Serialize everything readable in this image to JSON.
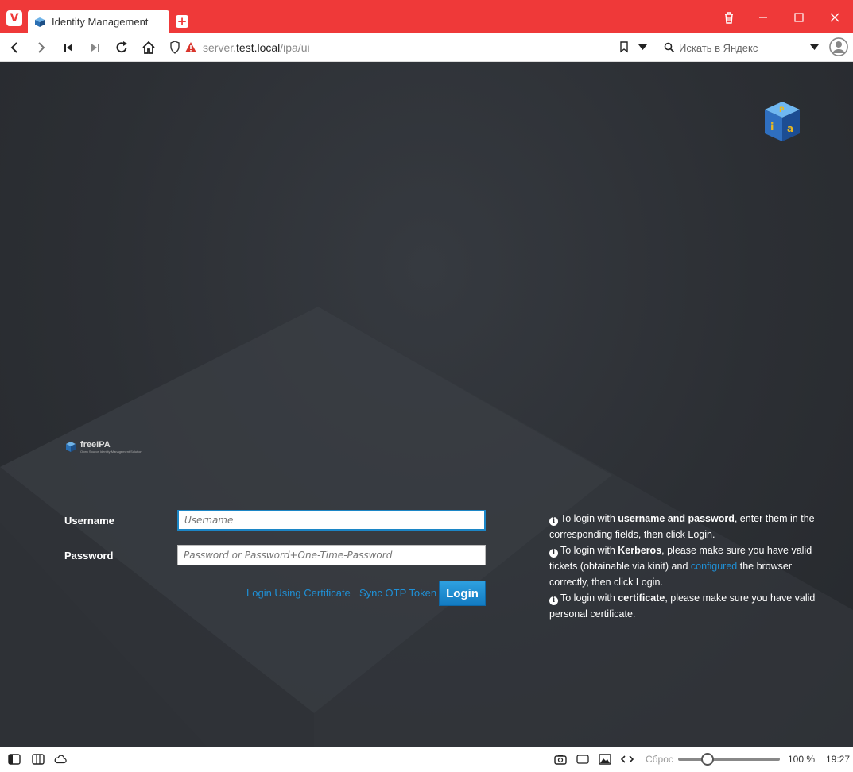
{
  "browser": {
    "tab_title": "Identity Management",
    "url_host": "server.test.local",
    "url_prefix": "server.",
    "url_domain": "test.local",
    "url_path": "/ipa/ui",
    "search_placeholder": "Искать в Яндекс",
    "accent_color": "#ef3939"
  },
  "brand": {
    "name": "freeIPA",
    "tagline": "Open Source Identity Management Solution"
  },
  "login_form": {
    "username_label": "Username",
    "username_placeholder": "Username",
    "password_label": "Password",
    "password_placeholder": "Password or Password+One-Time-Password",
    "cert_link": "Login Using Certificate",
    "otp_link": "Sync OTP Token",
    "login_button": "Login"
  },
  "help": {
    "p1_pre": "To login with ",
    "p1_bold": "username and password",
    "p1_post": ", enter them in the corresponding fields, then click Login.",
    "p2_pre": "To login with ",
    "p2_bold": "Kerberos",
    "p2_mid": ", please make sure you have valid tickets (obtainable via kinit) and ",
    "p2_link": "configured",
    "p2_post": " the browser correctly, then click Login.",
    "p3_pre": "To login with ",
    "p3_bold": "certificate",
    "p3_post": ", please make sure you have valid personal certificate."
  },
  "statusbar": {
    "reset_label": "Сброс",
    "zoom": "100 %",
    "zoom_level": 1.0,
    "clock": "19:27"
  }
}
